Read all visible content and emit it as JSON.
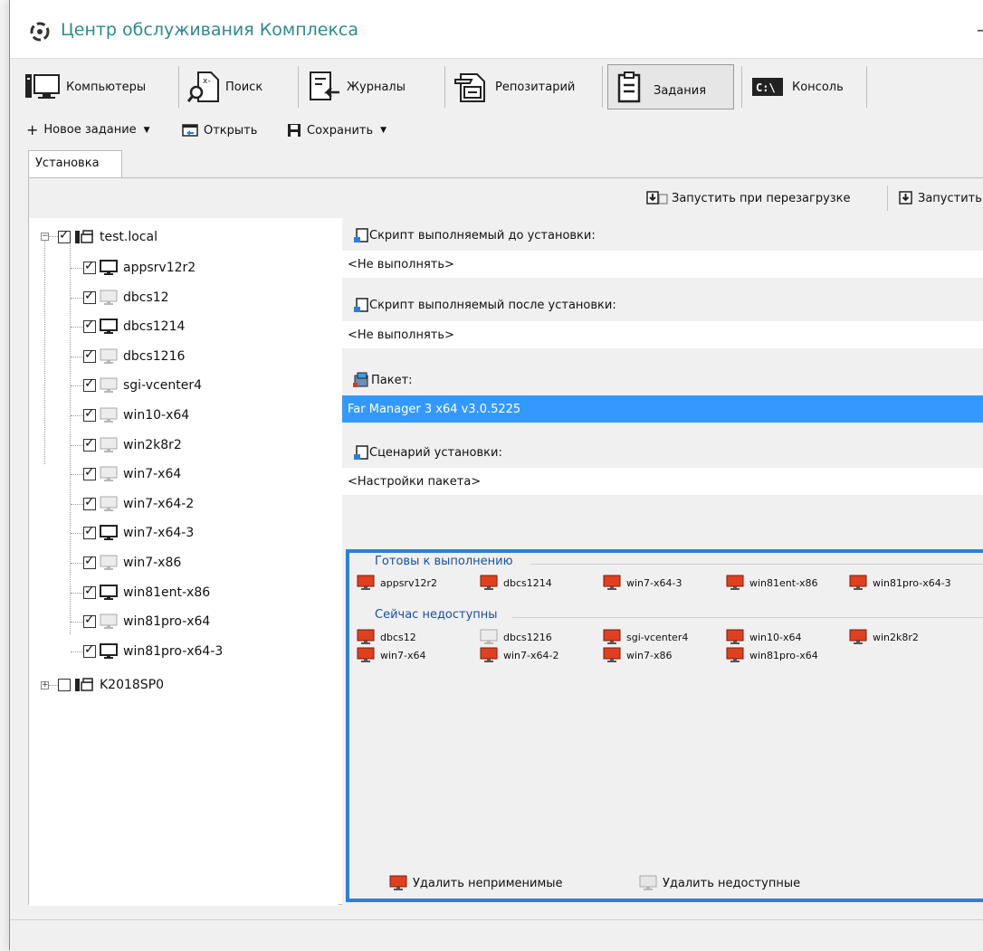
{
  "window": {
    "title": "Центр обслуживания Комплекса",
    "title_color": "#2e8a8a",
    "minimize_glyph": "–"
  },
  "main_toolbar": {
    "items": [
      {
        "label": "Компьютеры",
        "icon": "computers-icon"
      },
      {
        "label": "Поиск",
        "icon": "search-icon"
      },
      {
        "label": "Журналы",
        "icon": "journals-icon"
      },
      {
        "label": "Репозитарий",
        "icon": "repository-icon"
      },
      {
        "label": "Задания",
        "icon": "tasks-icon",
        "active": true
      },
      {
        "label": "Консоль",
        "icon": "console-icon",
        "icon_text": "C:\\"
      }
    ]
  },
  "sub_toolbar": {
    "new_task": "Новое задание",
    "open": "Открыть",
    "save": "Сохранить"
  },
  "tabs": [
    {
      "label": "Установка",
      "active": true
    }
  ],
  "run_bar": {
    "run_on_reboot": "Запустить при перезагрузке",
    "run": "Запустить"
  },
  "tree": {
    "root": {
      "label": "test.local",
      "checked": true,
      "expanded": true
    },
    "children": [
      {
        "label": "appsrv12r2",
        "checked": true,
        "online": true
      },
      {
        "label": "dbcs12",
        "checked": true,
        "online": false
      },
      {
        "label": "dbcs1214",
        "checked": true,
        "online": true
      },
      {
        "label": "dbcs1216",
        "checked": true,
        "online": false
      },
      {
        "label": "sgi-vcenter4",
        "checked": true,
        "online": false
      },
      {
        "label": "win10-x64",
        "checked": true,
        "online": false
      },
      {
        "label": "win2k8r2",
        "checked": true,
        "online": false
      },
      {
        "label": "win7-x64",
        "checked": true,
        "online": false
      },
      {
        "label": "win7-x64-2",
        "checked": true,
        "online": false
      },
      {
        "label": "win7-x64-3",
        "checked": true,
        "online": true
      },
      {
        "label": "win7-x86",
        "checked": true,
        "online": false
      },
      {
        "label": "win81ent-x86",
        "checked": true,
        "online": true
      },
      {
        "label": "win81pro-x64",
        "checked": true,
        "online": false
      },
      {
        "label": "win81pro-x64-3",
        "checked": true,
        "online": true
      }
    ],
    "root2": {
      "label": "K2018SP0",
      "checked": false,
      "expanded": false
    }
  },
  "form": {
    "pre_script_label": "Скрипт выполняемый до установки:",
    "pre_script_value": "<Не выполнять>",
    "post_script_label": "Скрипт выполняемый после установки:",
    "post_script_value": "<Не выполнять>",
    "package_label": "Пакет:",
    "package_value": "Far Manager 3 x64 v3.0.5225",
    "scenario_label": "Сценарий установки:",
    "scenario_value": "<Настройки пакета>"
  },
  "hosts": {
    "ready_title": "Готовы к выполнению",
    "ready": [
      {
        "label": "appsrv12r2",
        "state": "red"
      },
      {
        "label": "dbcs1214",
        "state": "red"
      },
      {
        "label": "win7-x64-3",
        "state": "red"
      },
      {
        "label": "win81ent-x86",
        "state": "red"
      },
      {
        "label": "win81pro-x64-3",
        "state": "red"
      }
    ],
    "unavailable_title": "Сейчас недоступны",
    "unavailable": [
      {
        "label": "dbcs12",
        "state": "red"
      },
      {
        "label": "dbcs1216",
        "state": "gray"
      },
      {
        "label": "sgi-vcenter4",
        "state": "red"
      },
      {
        "label": "win10-x64",
        "state": "red"
      },
      {
        "label": "win2k8r2",
        "state": "red"
      },
      {
        "label": "win7-x64",
        "state": "red"
      },
      {
        "label": "win7-x64-2",
        "state": "red"
      },
      {
        "label": "win7-x86",
        "state": "red"
      },
      {
        "label": "win81pro-x64",
        "state": "red"
      }
    ],
    "remove_inapplicable": "Удалить неприменимые",
    "remove_unavailable": "Удалить недоступные"
  },
  "colors": {
    "accent_blue": "#2d7fd8",
    "selection": "#3399ff",
    "monitor_red": "#e0401f",
    "monitor_gray": "#c8c8c8"
  }
}
